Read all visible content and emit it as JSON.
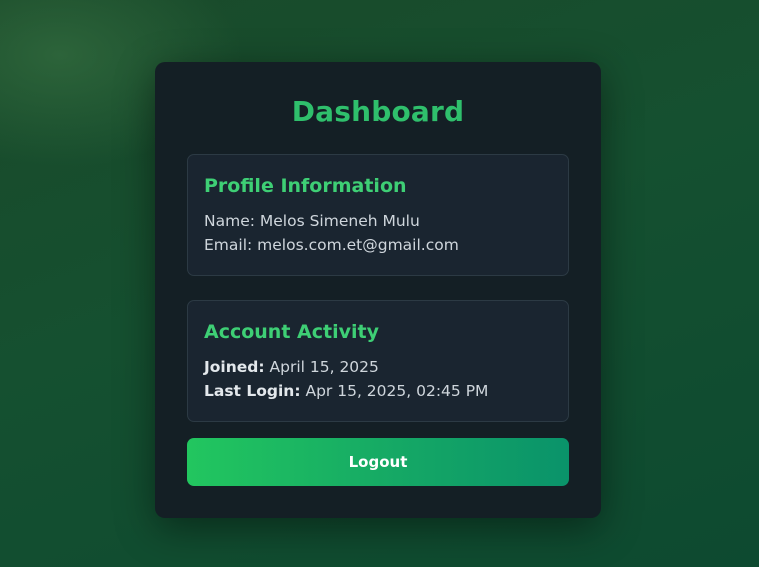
{
  "dashboard": {
    "title": "Dashboard"
  },
  "profile": {
    "title": "Profile Information",
    "name_label": "Name:",
    "name_value": "Melos Simeneh Mulu",
    "email_label": "Email:",
    "email_value": "melos.com.et@gmail.com"
  },
  "activity": {
    "title": "Account Activity",
    "joined_label": "Joined:",
    "joined_value": "April 15, 2025",
    "last_login_label": "Last Login:",
    "last_login_value": "Apr 15, 2025, 02:45 PM"
  },
  "actions": {
    "logout_label": "Logout"
  },
  "colors": {
    "accent": "#2fbf6c",
    "button_start": "#22c65f",
    "button_end": "#0a936a",
    "card_bg": "#141f25"
  }
}
